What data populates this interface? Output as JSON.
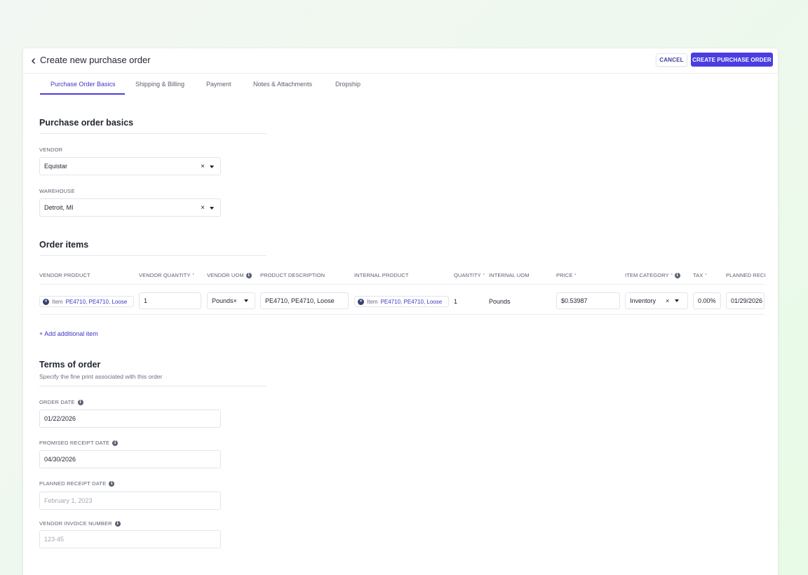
{
  "header": {
    "title": "Create new purchase order",
    "cancel_label": "CANCEL",
    "create_label": "CREATE PURCHASE ORDER"
  },
  "tabs": [
    {
      "label": "Purchase Order Basics",
      "active": true
    },
    {
      "label": "Shipping & Billing"
    },
    {
      "label": "Payment"
    },
    {
      "label": "Notes & Attachments"
    },
    {
      "label": "Dropship"
    }
  ],
  "basics": {
    "title": "Purchase order basics",
    "vendor_label": "VENDOR",
    "vendor_value": "Equistar",
    "warehouse_label": "WAREHOUSE",
    "warehouse_value": "Detroit, MI"
  },
  "order_items": {
    "title": "Order items",
    "columns": {
      "vendor_product": "VENDOR PRODUCT",
      "vendor_quantity": "VENDOR QUANTITY",
      "vendor_uom": "VENDOR UOM",
      "product_description": "PRODUCT DESCRIPTION",
      "internal_product": "INTERNAL PRODUCT",
      "quantity": "QUANTITY",
      "internal_uom": "INTERNAL UOM",
      "price": "PRICE",
      "item_category": "ITEM CATEGORY",
      "tax": "TAX",
      "planned_receipt": "PLANNED RECI"
    },
    "required_mark": "*",
    "row": {
      "vendor_product_tag": "Item",
      "vendor_product_value": "PE4710, PE4710, Loose",
      "vendor_quantity": "1",
      "vendor_uom": "Pounds",
      "product_description": "PE4710, PE4710, Loose",
      "internal_product_tag": "Item",
      "internal_product_value": "PE4710, PE4710, Loose",
      "quantity": "1",
      "internal_uom": "Pounds",
      "price": "$0.53987",
      "item_category": "Inventory",
      "tax": "0.00%",
      "planned_receipt": "01/29/2026"
    },
    "add_label": "+ Add additional item"
  },
  "terms": {
    "title": "Terms of order",
    "subtitle": "Specify the fine print associated with this order",
    "order_date_label": "ORDER DATE",
    "order_date_value": "01/22/2026",
    "promised_label": "PROMISED RECEIPT DATE",
    "promised_value": "04/30/2026",
    "planned_label": "PLANNED RECEIPT DATE",
    "planned_placeholder": "February 1, 2023",
    "invoice_label": "VENDOR INVOICE NUMBER",
    "invoice_placeholder": "123-45"
  },
  "icons": {
    "back": "chevron-left-icon",
    "info": "info-icon",
    "clear": "close-icon",
    "caret": "caret-down-icon"
  },
  "colors": {
    "accent": "#4a3ee0",
    "link": "#3f35c8"
  }
}
